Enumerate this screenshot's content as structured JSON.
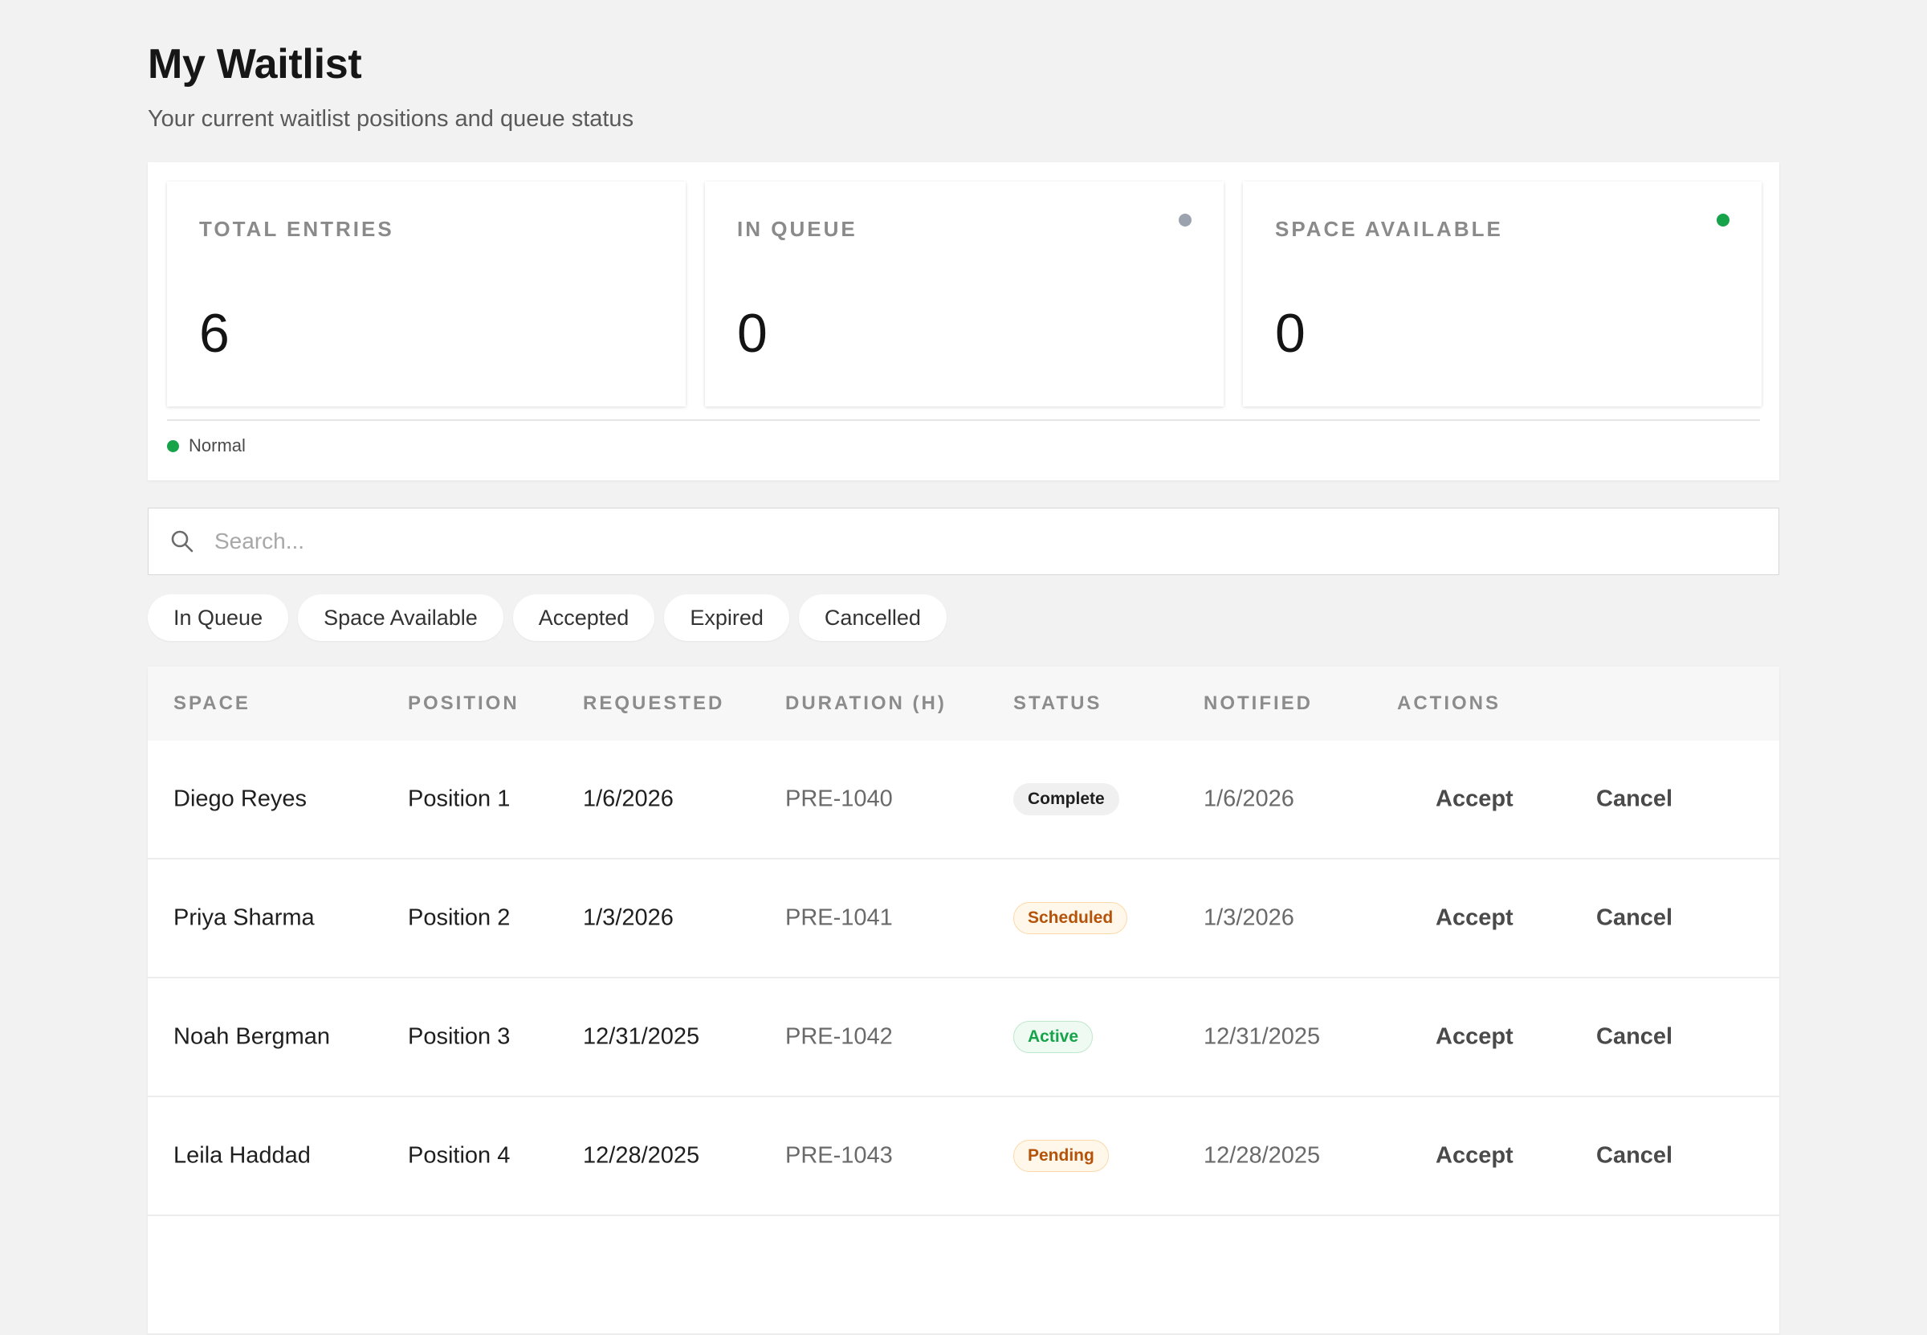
{
  "header": {
    "title": "My Waitlist",
    "subtitle": "Your current waitlist positions and queue status"
  },
  "stats": [
    {
      "label": "TOTAL ENTRIES",
      "value": "6",
      "dot_color": ""
    },
    {
      "label": "IN QUEUE",
      "value": "0",
      "dot_color": "#9ca3af"
    },
    {
      "label": "SPACE AVAILABLE",
      "value": "0",
      "dot_color": "#16a34a"
    }
  ],
  "legend": {
    "label": "Normal",
    "color": "#16a34a"
  },
  "search": {
    "placeholder": "Search...",
    "value": ""
  },
  "filters": [
    "In Queue",
    "Space Available",
    "Accepted",
    "Expired",
    "Cancelled"
  ],
  "table": {
    "headers": [
      "SPACE",
      "POSITION",
      "REQUESTED",
      "DURATION (H)",
      "STATUS",
      "NOTIFIED",
      "ACTIONS"
    ],
    "rows": [
      {
        "space": "Diego Reyes",
        "position": "Position 1",
        "requested": "1/6/2026",
        "duration": "PRE-1040",
        "status": "Complete",
        "status_kind": "complete",
        "notified": "1/6/2026",
        "accept": "Accept",
        "cancel": "Cancel"
      },
      {
        "space": "Priya Sharma",
        "position": "Position 2",
        "requested": "1/3/2026",
        "duration": "PRE-1041",
        "status": "Scheduled",
        "status_kind": "scheduled",
        "notified": "1/3/2026",
        "accept": "Accept",
        "cancel": "Cancel"
      },
      {
        "space": "Noah Bergman",
        "position": "Position 3",
        "requested": "12/31/2025",
        "duration": "PRE-1042",
        "status": "Active",
        "status_kind": "active",
        "notified": "12/31/2025",
        "accept": "Accept",
        "cancel": "Cancel"
      },
      {
        "space": "Leila Haddad",
        "position": "Position 4",
        "requested": "12/28/2025",
        "duration": "PRE-1043",
        "status": "Pending",
        "status_kind": "pending",
        "notified": "12/28/2025",
        "accept": "Accept",
        "cancel": "Cancel"
      }
    ]
  },
  "status_colors": {
    "complete": {
      "bg": "#f0f0f0",
      "fg": "#1f1f1f",
      "border": "#f0f0f0"
    },
    "scheduled": {
      "bg": "#fff7ea",
      "fg": "#b45309",
      "border": "#fcd9a8"
    },
    "active": {
      "bg": "#effaf3",
      "fg": "#16a34a",
      "border": "#bfe7cc"
    },
    "pending": {
      "bg": "#fff7ea",
      "fg": "#b45309",
      "border": "#fcd9a8"
    }
  }
}
